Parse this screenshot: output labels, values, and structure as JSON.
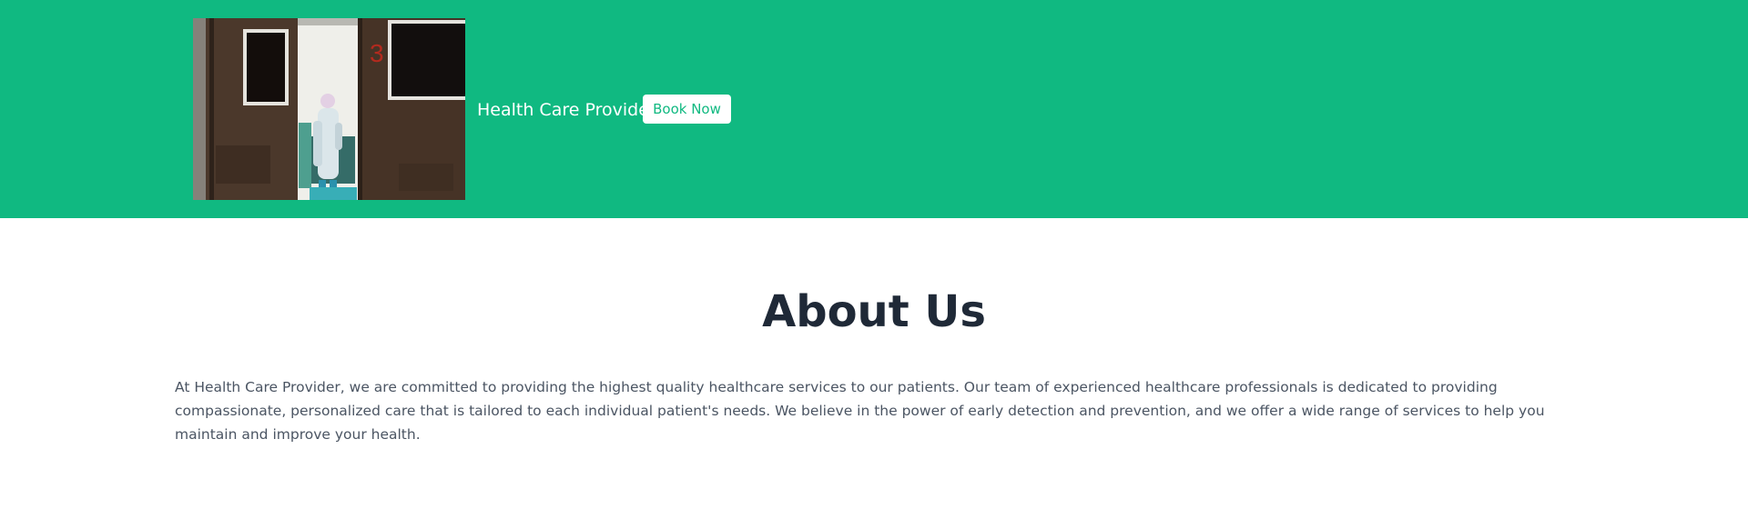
{
  "header": {
    "background_color": "#10b981",
    "image": {
      "description": "hospital operating room doorway with a masked medical worker in protective gown",
      "door_number": "3"
    },
    "brand_name": "Health Care Provider",
    "book_button_label": "Book Now"
  },
  "about": {
    "title": "About Us",
    "text": "At Health Care Provider, we are committed to providing the highest quality healthcare services to our patients. Our team of experienced healthcare professionals is dedicated to providing compassionate, personalized care that is tailored to each individual patient's needs. We believe in the power of early detection and prevention, and we offer a wide range of services to help you maintain and improve your health."
  },
  "colors": {
    "brand_green": "#10b981",
    "white": "#ffffff",
    "title_dark": "#1f2937",
    "body_gray": "#4b5563"
  }
}
